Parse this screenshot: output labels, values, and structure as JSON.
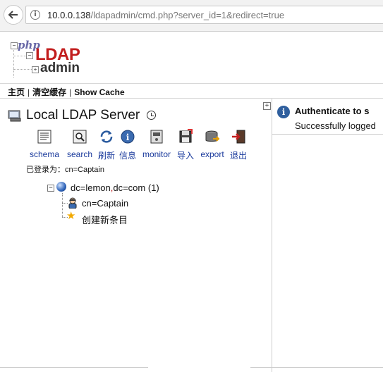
{
  "browser": {
    "url_host": "10.0.0.138",
    "url_path": "/ldapadmin/cmd.php?server_id=1&redirect=true"
  },
  "logo": {
    "php": "php",
    "ldap": "LDAP",
    "admin": "admin"
  },
  "menu": {
    "home": "主页",
    "purge_cache": "清空缓存",
    "show_cache": "Show Cache"
  },
  "server": {
    "title": "Local LDAP Server"
  },
  "toolbar": [
    {
      "label": "schema",
      "icon": "schema-icon"
    },
    {
      "label": "search",
      "icon": "search-icon"
    },
    {
      "label": "刷新",
      "icon": "refresh-icon"
    },
    {
      "label": "信息",
      "icon": "info-icon"
    },
    {
      "label": "monitor",
      "icon": "monitor-icon"
    },
    {
      "label": "导入",
      "icon": "import-icon"
    },
    {
      "label": "export",
      "icon": "export-icon"
    },
    {
      "label": "退出",
      "icon": "logout-icon"
    }
  ],
  "logged_in_as": "已登录为：cn=Captain",
  "tree": {
    "root": {
      "dn_part1": "dc=lemon",
      "comma": ",",
      "dn_part2": "dc=com",
      "count": "(1)"
    },
    "children": [
      {
        "label": "cn=Captain"
      }
    ],
    "create_entry": "创建新条目"
  },
  "message": {
    "title": "Authenticate to s",
    "body": "Successfully logged"
  }
}
